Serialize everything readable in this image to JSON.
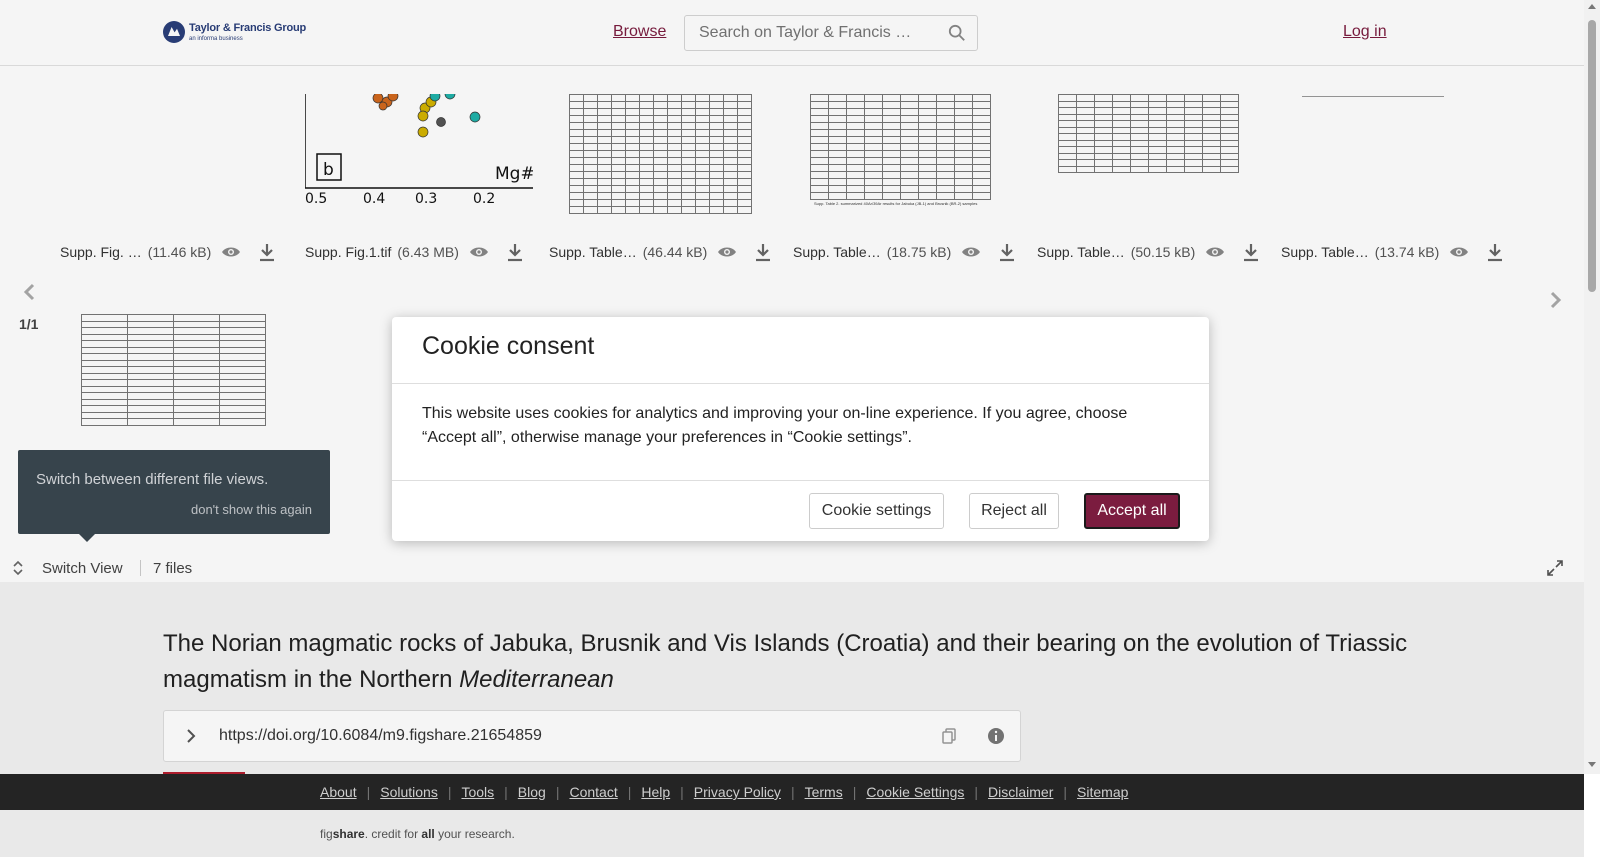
{
  "header": {
    "logo_line1": "Taylor & Francis Group",
    "logo_line2": "an informa business",
    "browse": "Browse",
    "search_placeholder": "Search on Taylor & Francis …",
    "login": "Log in"
  },
  "viewer": {
    "files": [
      {
        "name": "Supp. Fig. …",
        "size": "(11.46 kB)"
      },
      {
        "name": "Supp. Fig.1.tif",
        "size": "(6.43 MB)"
      },
      {
        "name": "Supp. Table…",
        "size": "(46.44 kB)"
      },
      {
        "name": "Supp. Table…",
        "size": "(18.75 kB)"
      },
      {
        "name": "Supp. Table…",
        "size": "(50.15 kB)"
      },
      {
        "name": "Supp. Table…",
        "size": "(13.74 kB)"
      }
    ],
    "figure_preview": {
      "panel_label": "b",
      "axis_label": "Mg#",
      "ticks": [
        "0.5",
        "0.4",
        "0.3",
        "0.2"
      ]
    },
    "table_caption": "Supp. Table 2. summarized 40Ar/39Ar results for Jabuka (JB-1) and Brusnik (BR-2) samples",
    "pager": "1/1",
    "tooltip": {
      "message": "Switch between different file views.",
      "dismiss": "don't show this again"
    },
    "switch_view": "Switch View",
    "files_count": "7 files"
  },
  "article": {
    "title_main": "The Norian magmatic rocks of Jabuka, Brusnik and Vis Islands (Croatia) and their bearing on the evolution of Triassic magmatism in the Northern ",
    "title_italic": "Mediterranean",
    "doi": "https://doi.org/10.6084/m9.figshare.21654859"
  },
  "footer": {
    "links": [
      "About",
      "Solutions",
      "Tools",
      "Blog",
      "Contact",
      "Help",
      "Privacy Policy",
      "Terms",
      "Cookie Settings",
      "Disclaimer",
      "Sitemap"
    ],
    "tagline_pre": "fig",
    "tagline_bold1": "share",
    "tagline_mid": ". credit for ",
    "tagline_bold2": "all",
    "tagline_post": " your research."
  },
  "cookie_modal": {
    "title": "Cookie consent",
    "body": "This website uses cookies for analytics and improving your on-line experience. If you agree, choose “Accept all”, otherwise manage your preferences in “Cookie settings”.",
    "settings_button": "Cookie settings",
    "reject_button": "Reject all",
    "accept_button": "Accept all"
  },
  "colors": {
    "brand": "#7b1c3f",
    "footer_bg": "#262626",
    "tooltip_bg": "#3a4750"
  }
}
